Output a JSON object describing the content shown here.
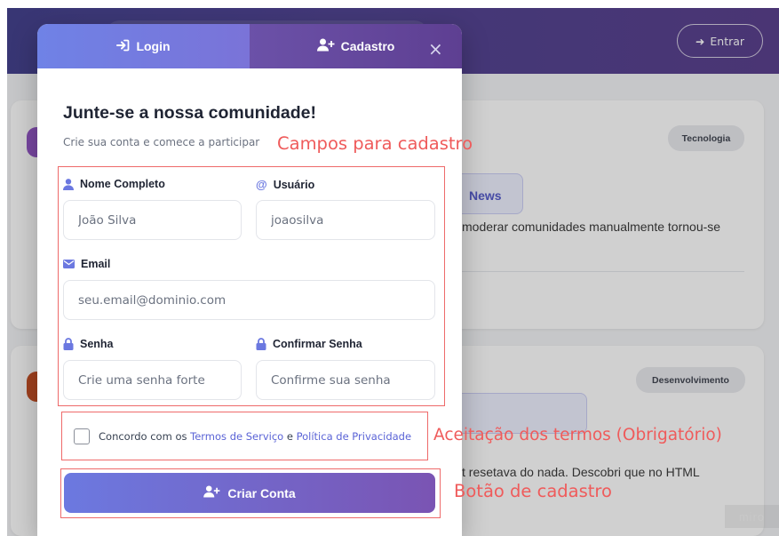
{
  "header": {
    "entrar_label": "Entrar"
  },
  "background": {
    "tag_1": "Tecnologia",
    "tag_2": "Desenvolvimento",
    "news_chip": "News",
    "card1_text": "moderar comunidades manualmente tornou-se",
    "card2_text": "ct resetava do nada. Descobri que no HTML"
  },
  "modal": {
    "tabs": [
      {
        "label": "Login",
        "icon": "sign-in-icon"
      },
      {
        "label": "Cadastro",
        "icon": "user-plus-icon"
      }
    ],
    "close_glyph": "×",
    "title": "Junte-se a nossa comunidade!",
    "subtitle": "Crie sua conta e comece a participar",
    "fields": {
      "nome": {
        "label": "Nome Completo",
        "placeholder": "João Silva",
        "icon": "user-icon"
      },
      "usuario": {
        "label": "Usuário",
        "placeholder": "joaosilva",
        "icon": "at-icon"
      },
      "email": {
        "label": "Email",
        "placeholder": "seu.email@dominio.com",
        "icon": "envelope-icon"
      },
      "senha": {
        "label": "Senha",
        "placeholder": "Crie uma senha forte",
        "icon": "lock-icon"
      },
      "confirmar": {
        "label": "Confirmar Senha",
        "placeholder": "Confirme sua senha",
        "icon": "lock-icon"
      }
    },
    "terms": {
      "prefix": "Concordo com os",
      "link_terms": "Termos de Serviço",
      "conjunction": "e",
      "link_privacy": "Política de Privacidade",
      "checked": false
    },
    "submit_label": "Criar Conta"
  },
  "annotations": {
    "campos": "Campos para cadastro",
    "termos": "Aceitação dos termos (Obrigatório)",
    "botao": "Botão de cadastro"
  },
  "watermark": "miro",
  "colors": {
    "accent": "#6b78e0",
    "annotation": "#ef5b5b",
    "link": "#5a63d6"
  }
}
